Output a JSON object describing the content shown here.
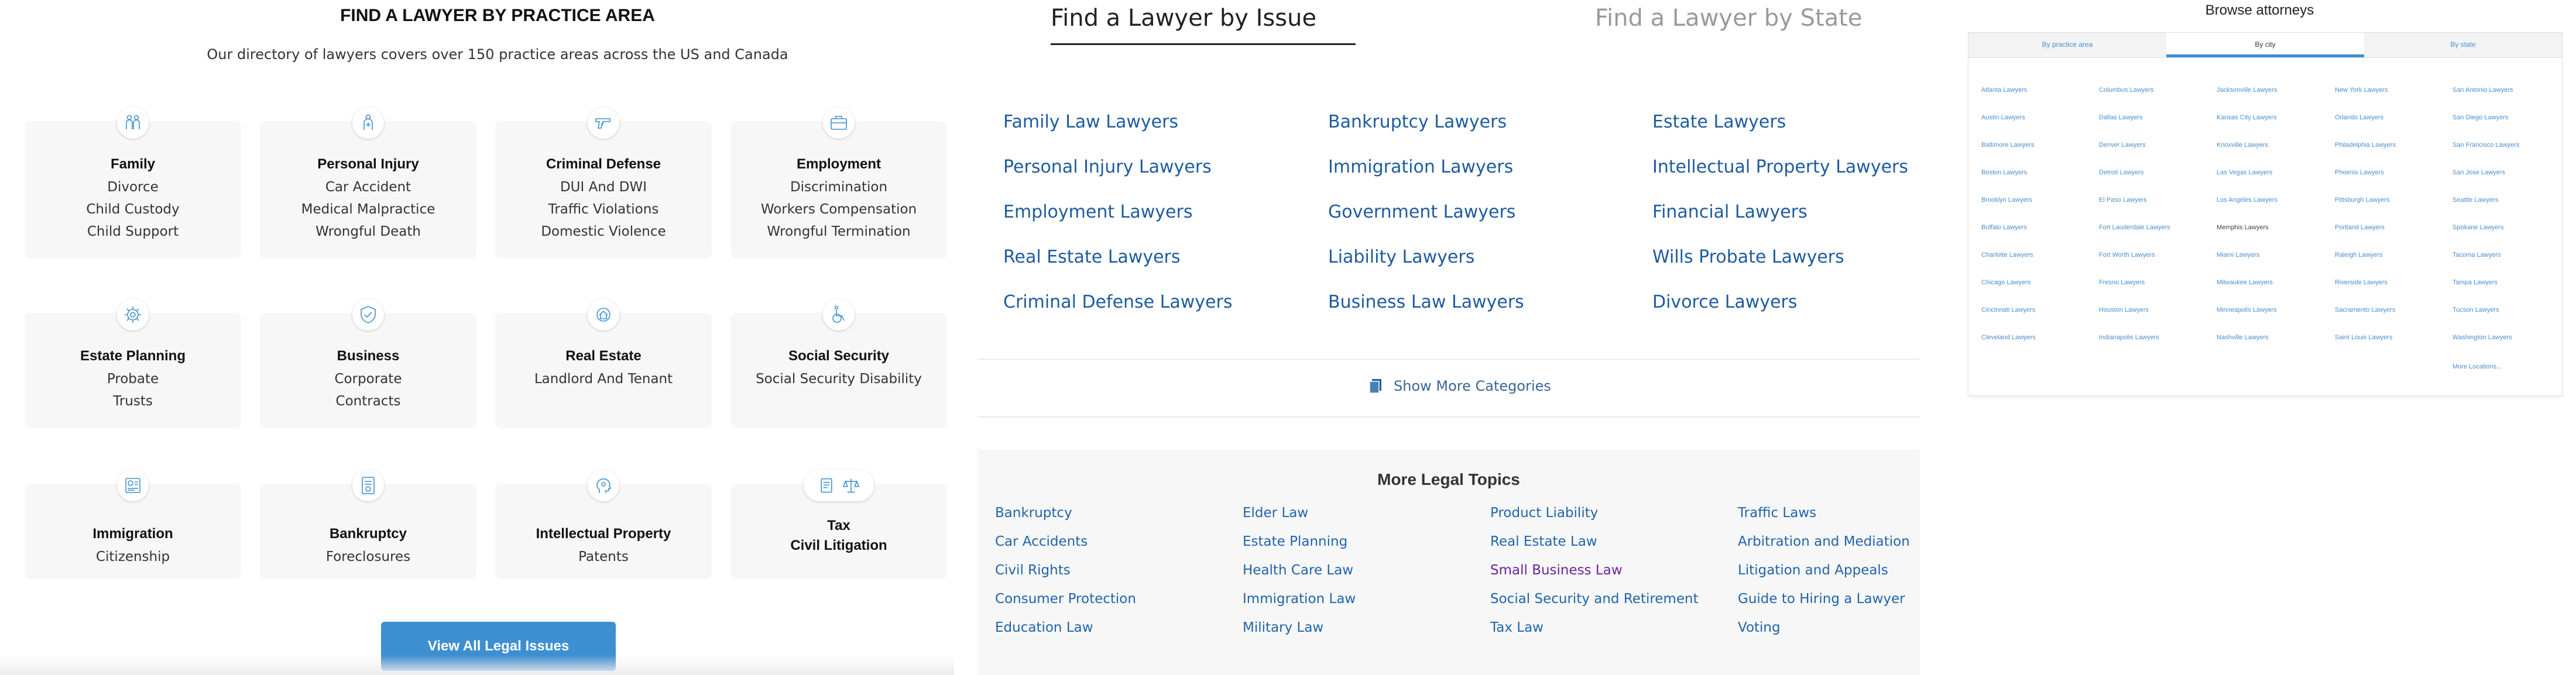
{
  "practice": {
    "title": "FIND A LAWYER BY PRACTICE AREA",
    "subtitle": "Our directory of lawyers covers over 150 practice areas across the US and Canada",
    "cards": [
      {
        "name": "Family",
        "icon": "family-icon",
        "subs": [
          "Divorce",
          "Child Custody",
          "Child Support"
        ]
      },
      {
        "name": "Personal Injury",
        "icon": "personal-injury-icon",
        "subs": [
          "Car Accident",
          "Medical Malpractice",
          "Wrongful Death"
        ]
      },
      {
        "name": "Criminal Defense",
        "icon": "handgun-icon",
        "subs": [
          "DUI And DWI",
          "Traffic Violations",
          "Domestic Violence"
        ]
      },
      {
        "name": "Employment",
        "icon": "briefcase-icon",
        "subs": [
          "Discrimination",
          "Workers Compensation",
          "Wrongful Termination"
        ]
      },
      {
        "name": "Estate Planning",
        "icon": "estate-gear-icon",
        "subs": [
          "Probate",
          "Trusts"
        ]
      },
      {
        "name": "Business",
        "icon": "shield-icon",
        "subs": [
          "Corporate",
          "Contracts"
        ]
      },
      {
        "name": "Real Estate",
        "icon": "house-gear-icon",
        "subs": [
          "Landlord And Tenant"
        ]
      },
      {
        "name": "Social Security",
        "icon": "wheelchair-icon",
        "subs": [
          "Social Security Disability"
        ]
      },
      {
        "name": "Immigration",
        "icon": "passport-icon",
        "subs": [
          "Citizenship"
        ]
      },
      {
        "name": "Bankruptcy",
        "icon": "bankruptcy-document-icon",
        "subs": [
          "Foreclosures"
        ]
      },
      {
        "name": "Intellectual Property",
        "icon": "idea-head-icon",
        "subs": [
          "Patents"
        ]
      },
      {
        "name": "Tax",
        "icon": "tax-icons",
        "subs": [
          "Civil Litigation"
        ]
      }
    ],
    "view_all": "View All Legal Issues"
  },
  "issues": {
    "tabs": {
      "active": "Find a Lawyer by Issue",
      "inactive": "Find a Lawyer by State"
    },
    "columns": [
      [
        "Family Law Lawyers",
        "Personal Injury Lawyers",
        "Employment Lawyers",
        "Real Estate Lawyers",
        "Criminal Defense Lawyers"
      ],
      [
        "Bankruptcy Lawyers",
        "Immigration Lawyers",
        "Government Lawyers",
        "Liability Lawyers",
        "Business Law Lawyers"
      ],
      [
        "Estate Lawyers",
        "Intellectual Property Lawyers",
        "Financial Lawyers",
        "Wills Probate Lawyers",
        "Divorce Lawyers"
      ]
    ],
    "show_more": "Show More Categories",
    "more_title": "More Legal Topics",
    "topic_columns": [
      [
        "Bankruptcy",
        "Car Accidents",
        "Civil Rights",
        "Consumer Protection",
        "Education Law"
      ],
      [
        "Elder Law",
        "Estate Planning",
        "Health Care Law",
        "Immigration Law",
        "Military Law"
      ],
      [
        "Product Liability",
        "Real Estate Law",
        "Small Business Law",
        "Social Security and Retirement",
        "Tax Law"
      ],
      [
        "Traffic Laws",
        "Arbitration and Mediation",
        "Litigation and Appeals",
        "Guide to Hiring a Lawyer",
        "Voting"
      ]
    ]
  },
  "browse": {
    "title": "Browse attorneys",
    "tabs": [
      "By practice area",
      "By city",
      "By state"
    ],
    "city_columns": [
      [
        "Atlanta Lawyers",
        "Austin Lawyers",
        "Baltimore Lawyers",
        "Boston Lawyers",
        "Brooklyn Lawyers",
        "Buffalo Lawyers",
        "Charlotte Lawyers",
        "Chicago Lawyers",
        "Cincinnati Lawyers",
        "Cleveland Lawyers"
      ],
      [
        "Columbus Lawyers",
        "Dallas Lawyers",
        "Denver Lawyers",
        "Detroit Lawyers",
        "El Paso Lawyers",
        "Fort Lauderdale Lawyers",
        "Fort Worth Lawyers",
        "Fresno Lawyers",
        "Houston Lawyers",
        "Indianapolis Lawyers"
      ],
      [
        "Jacksonville Lawyers",
        "Kansas City Lawyers",
        "Knoxville Lawyers",
        "Las Vegas Lawyers",
        "Los Angeles Lawyers",
        "Memphis Lawyers",
        "Miami Lawyers",
        "Milwaukee Lawyers",
        "Minneapolis Lawyers",
        "Nashville Lawyers"
      ],
      [
        "New York Lawyers",
        "Orlando Lawyers",
        "Philadelphia Lawyers",
        "Phoenix Lawyers",
        "Pittsburgh Lawyers",
        "Portland Lawyers",
        "Raleigh Lawyers",
        "Riverside Lawyers",
        "Sacramento Lawyers",
        "Saint Louis Lawyers"
      ],
      [
        "San Antonio Lawyers",
        "San Diego Lawyers",
        "San Francisco Lawyers",
        "San Jose Lawyers",
        "Seattle Lawyers",
        "Spokane Lawyers",
        "Tacoma Lawyers",
        "Tampa Lawyers",
        "Tucson Lawyers",
        "Washington Lawyers",
        "More Locations..."
      ]
    ]
  },
  "colors": {
    "accent": "#3d8fd1",
    "link": "#1e5b9e",
    "visited": "#6b239e",
    "card_bg": "#f7f7f7"
  }
}
